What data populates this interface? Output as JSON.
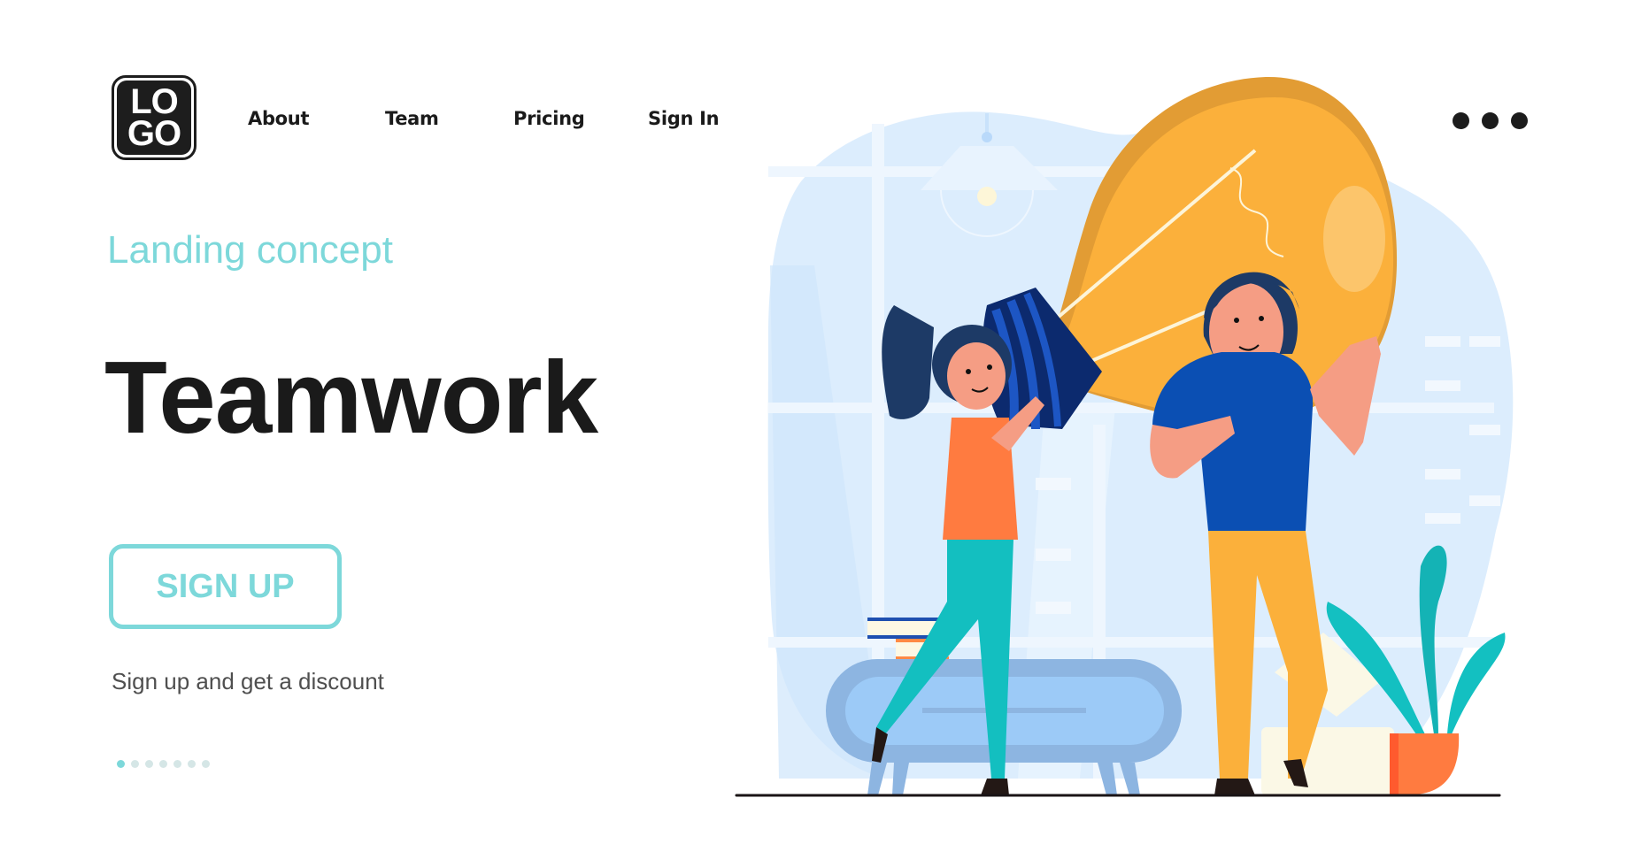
{
  "header": {
    "logo": {
      "line1": "LO",
      "line2": "GO"
    },
    "nav": [
      {
        "label": "About"
      },
      {
        "label": "Team"
      },
      {
        "label": "Pricing"
      },
      {
        "label": "Sign In"
      }
    ],
    "more_icon": "more-horizontal-icon"
  },
  "hero": {
    "eyebrow": "Landing concept",
    "title": "Teamwork",
    "cta_label": "SIGN UP",
    "subtext": "Sign up and get a discount",
    "pager": {
      "total": 7,
      "active_index": 0
    }
  },
  "illustration": {
    "description": "Two people carrying a giant light bulb in an office",
    "colors": {
      "accent": "#7dd8da",
      "bulb": "#fbb03b",
      "bulb_shade": "#e09a35",
      "base": "#1e3f99",
      "shirt_man": "#0b4fb3",
      "pants_man": "#fbb03b",
      "shirt_woman": "#ff7b40",
      "pants_woman": "#13bfc0",
      "background_blob": "#dbeeff",
      "sofa": "#9ccaf7",
      "plant": "#14b3b5",
      "pot": "#ff6b35"
    }
  }
}
